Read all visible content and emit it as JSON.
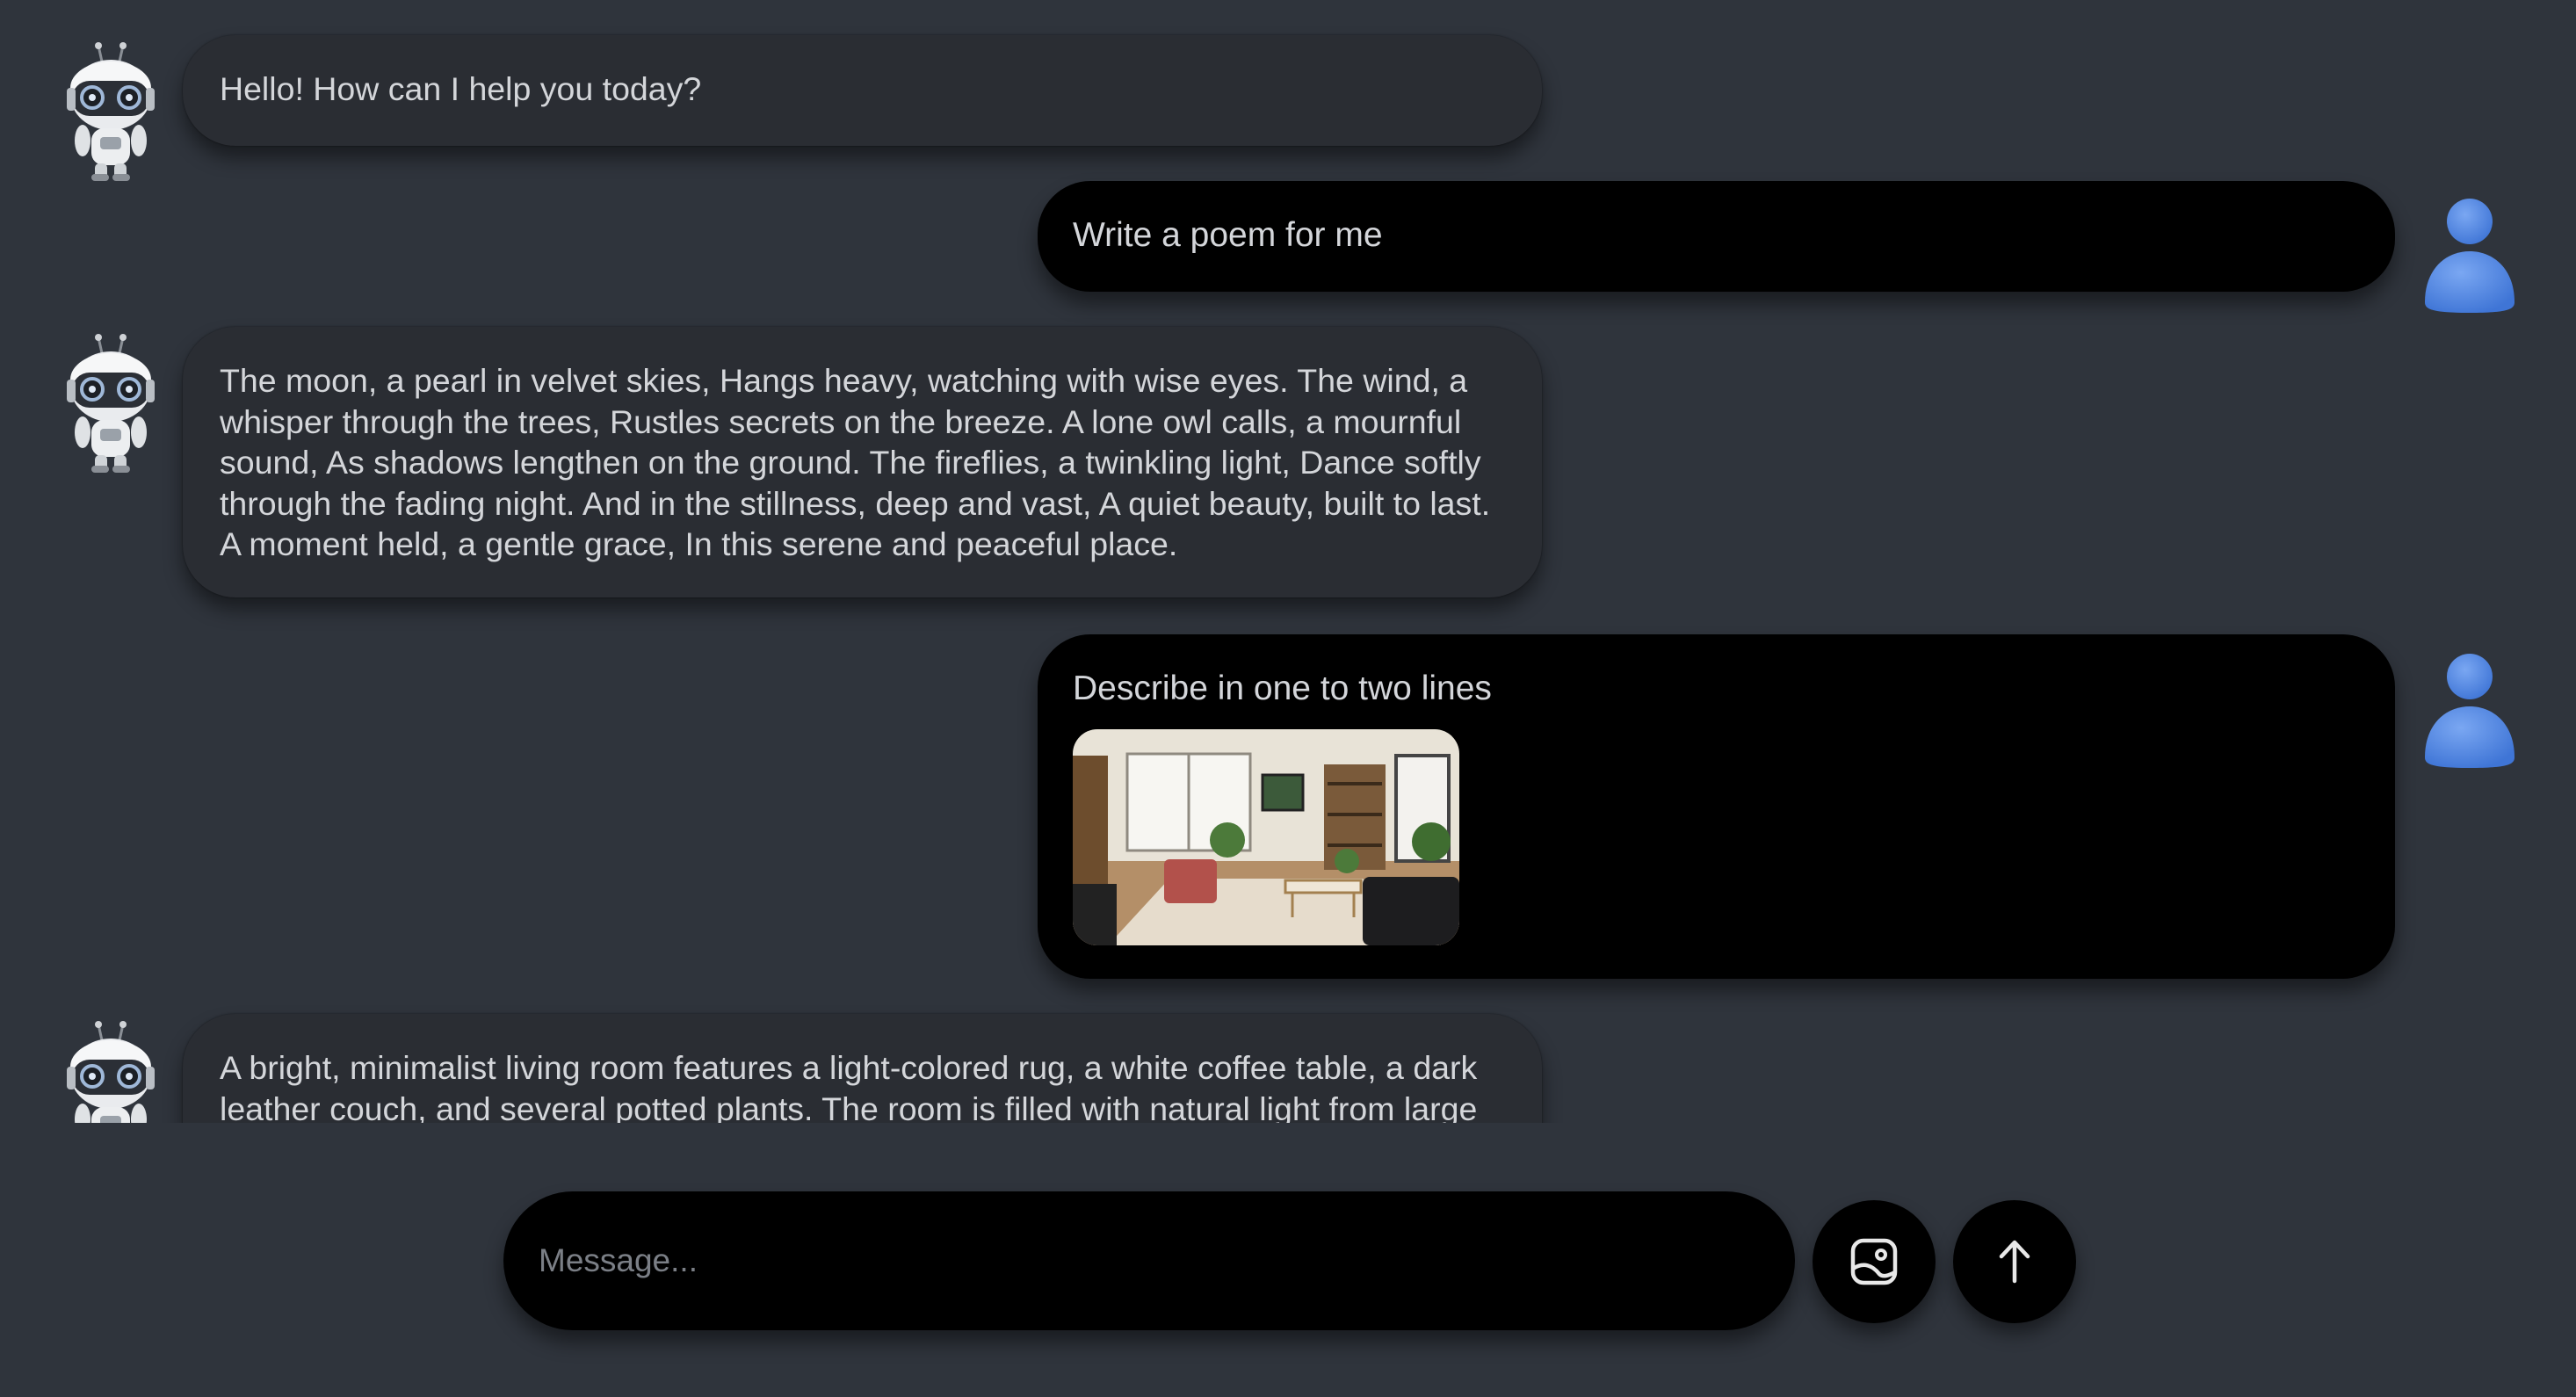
{
  "messages": [
    {
      "role": "bot",
      "text": "Hello! How can I help you today?"
    },
    {
      "role": "user",
      "text": "Write a poem for me"
    },
    {
      "role": "bot",
      "text": "The moon, a pearl in velvet skies, Hangs heavy, watching with wise eyes. The wind, a whisper through the trees, Rustles secrets on the breeze. A lone owl calls, a mournful sound, As shadows lengthen on the ground. The fireflies, a twinkling light, Dance softly through the fading night. And in the stillness, deep and vast, A quiet beauty, built to last. A moment held, a gentle grace, In this serene and peaceful place."
    },
    {
      "role": "user",
      "text": "Describe in one to two lines",
      "attachment": "living-room-photo"
    },
    {
      "role": "bot",
      "text": "A bright, minimalist living room features a light-colored rug, a white coffee table, a dark leather couch, and several potted plants. The room is filled with natural light from large"
    }
  ],
  "composer": {
    "placeholder": "Message..."
  },
  "icons": {
    "bot_avatar": "robot-icon",
    "user_avatar": "user-icon",
    "image_upload": "image-upload-icon",
    "send": "arrow-up-icon"
  },
  "colors": {
    "background": "#2f343c",
    "bot_bubble": "#2a2d33",
    "user_bubble": "#000000",
    "user_avatar": "#4f86e6",
    "text": "#d4d6da"
  }
}
